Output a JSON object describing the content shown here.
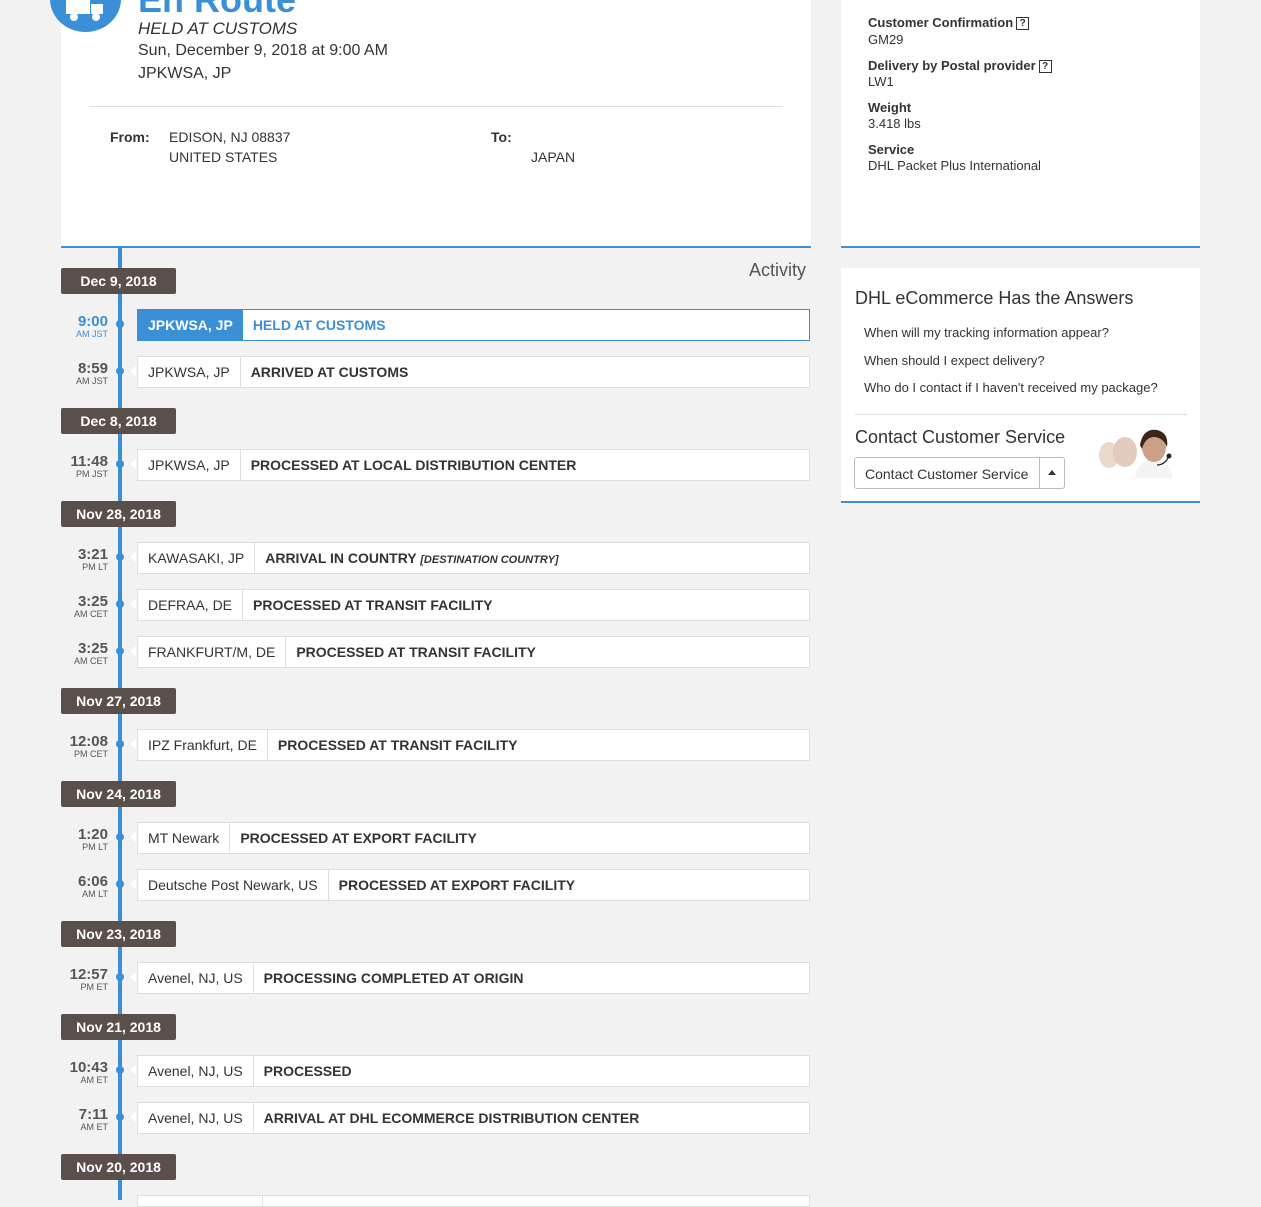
{
  "summary": {
    "status_title": "En Route",
    "status_sub": "HELD AT CUSTOMS",
    "status_date": "Sun, December 9, 2018 at 9:00 AM",
    "status_location": "JPKWSA, JP",
    "from_label": "From:",
    "from_line1": "EDISON, NJ 08837",
    "from_line2": "UNITED STATES",
    "to_label": "To:",
    "to_line1": "",
    "to_line2": "JAPAN"
  },
  "details": {
    "customer_confirmation_label": "Customer Confirmation",
    "customer_confirmation_value": "GM29",
    "postal_provider_label": "Delivery by Postal provider",
    "postal_provider_value": "LW1",
    "weight_label": "Weight",
    "weight_value": "3.418 lbs",
    "service_label": "Service",
    "service_value": "DHL Packet Plus International",
    "help_glyph": "?"
  },
  "faq": {
    "title": "DHL eCommerce Has the Answers",
    "links": [
      "When will my tracking information appear?",
      "When should I expect delivery?",
      "Who do I contact if I haven't received my package?"
    ],
    "cs_title": "Contact Customer Service",
    "cs_button": "Contact Customer Service"
  },
  "activity": {
    "title": "Activity",
    "dates": [
      "Dec 9, 2018",
      "Dec 8, 2018",
      "Nov 28, 2018",
      "Nov 27, 2018",
      "Nov 24, 2018",
      "Nov 23, 2018",
      "Nov 21, 2018",
      "Nov 20, 2018"
    ],
    "events": [
      {
        "time": "9:00",
        "zone": "AM JST",
        "location": "JPKWSA, JP",
        "description": "HELD AT CUSTOMS",
        "note": ""
      },
      {
        "time": "8:59",
        "zone": "AM JST",
        "location": "JPKWSA, JP",
        "description": "ARRIVED AT CUSTOMS",
        "note": ""
      },
      {
        "time": "11:48",
        "zone": "PM JST",
        "location": "JPKWSA, JP",
        "description": "PROCESSED AT LOCAL DISTRIBUTION CENTER",
        "note": ""
      },
      {
        "time": "3:21",
        "zone": "PM LT",
        "location": "KAWASAKI, JP",
        "description": "ARRIVAL IN COUNTRY",
        "note": "[DESTINATION COUNTRY]"
      },
      {
        "time": "3:25",
        "zone": "AM CET",
        "location": "DEFRAA, DE",
        "description": "PROCESSED AT TRANSIT FACILITY",
        "note": ""
      },
      {
        "time": "3:25",
        "zone": "AM CET",
        "location": "FRANKFURT/M, DE",
        "description": "PROCESSED AT TRANSIT FACILITY",
        "note": ""
      },
      {
        "time": "12:08",
        "zone": "PM CET",
        "location": "IPZ Frankfurt, DE",
        "description": "PROCESSED AT TRANSIT FACILITY",
        "note": ""
      },
      {
        "time": "1:20",
        "zone": "PM LT",
        "location": "MT Newark",
        "description": "PROCESSED AT EXPORT FACILITY",
        "note": ""
      },
      {
        "time": "6:06",
        "zone": "AM LT",
        "location": "Deutsche Post Newark, US",
        "description": "PROCESSED AT EXPORT FACILITY",
        "note": ""
      },
      {
        "time": "12:57",
        "zone": "PM ET",
        "location": "Avenel, NJ, US",
        "description": "PROCESSING COMPLETED AT ORIGIN",
        "note": ""
      },
      {
        "time": "10:43",
        "zone": "AM ET",
        "location": "Avenel, NJ, US",
        "description": "PROCESSED",
        "note": ""
      },
      {
        "time": "7:11",
        "zone": "AM ET",
        "location": "Avenel, NJ, US",
        "description": "ARRIVAL AT DHL ECOMMERCE DISTRIBUTION CENTER",
        "note": ""
      }
    ]
  },
  "colors": {
    "accent": "#3a8fd6",
    "date_badge": "#5a4f4a",
    "background": "#f2f2f2"
  }
}
